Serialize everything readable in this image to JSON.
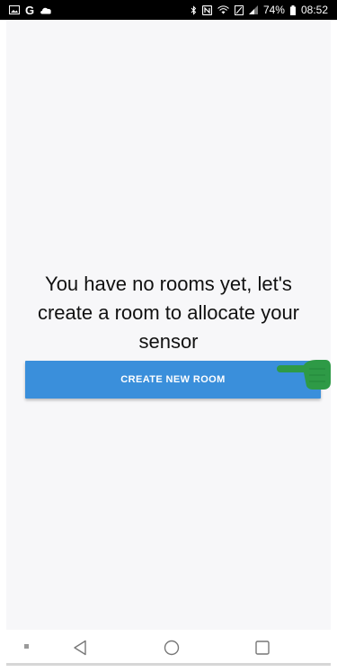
{
  "status_bar": {
    "left_icons": [
      "gallery-icon",
      "google-icon",
      "cloud-icon"
    ],
    "g_label": "G",
    "right_icons": [
      "bluetooth-icon",
      "nfc-icon",
      "wifi-icon",
      "data-saver-icon",
      "signal-icon",
      "battery-icon"
    ],
    "battery_percent": "74%",
    "time": "08:52"
  },
  "main": {
    "empty_message": "You have no rooms yet, let's create a room to allocate your sensor",
    "create_button_label": "CREATE NEW ROOM"
  },
  "colors": {
    "background": "#f7f7f9",
    "button": "#3a8fdb",
    "pointer": "#2e9a46"
  },
  "nav_bar": {
    "icons": [
      "recents-dot-icon",
      "back-icon",
      "home-icon",
      "overview-icon"
    ]
  }
}
